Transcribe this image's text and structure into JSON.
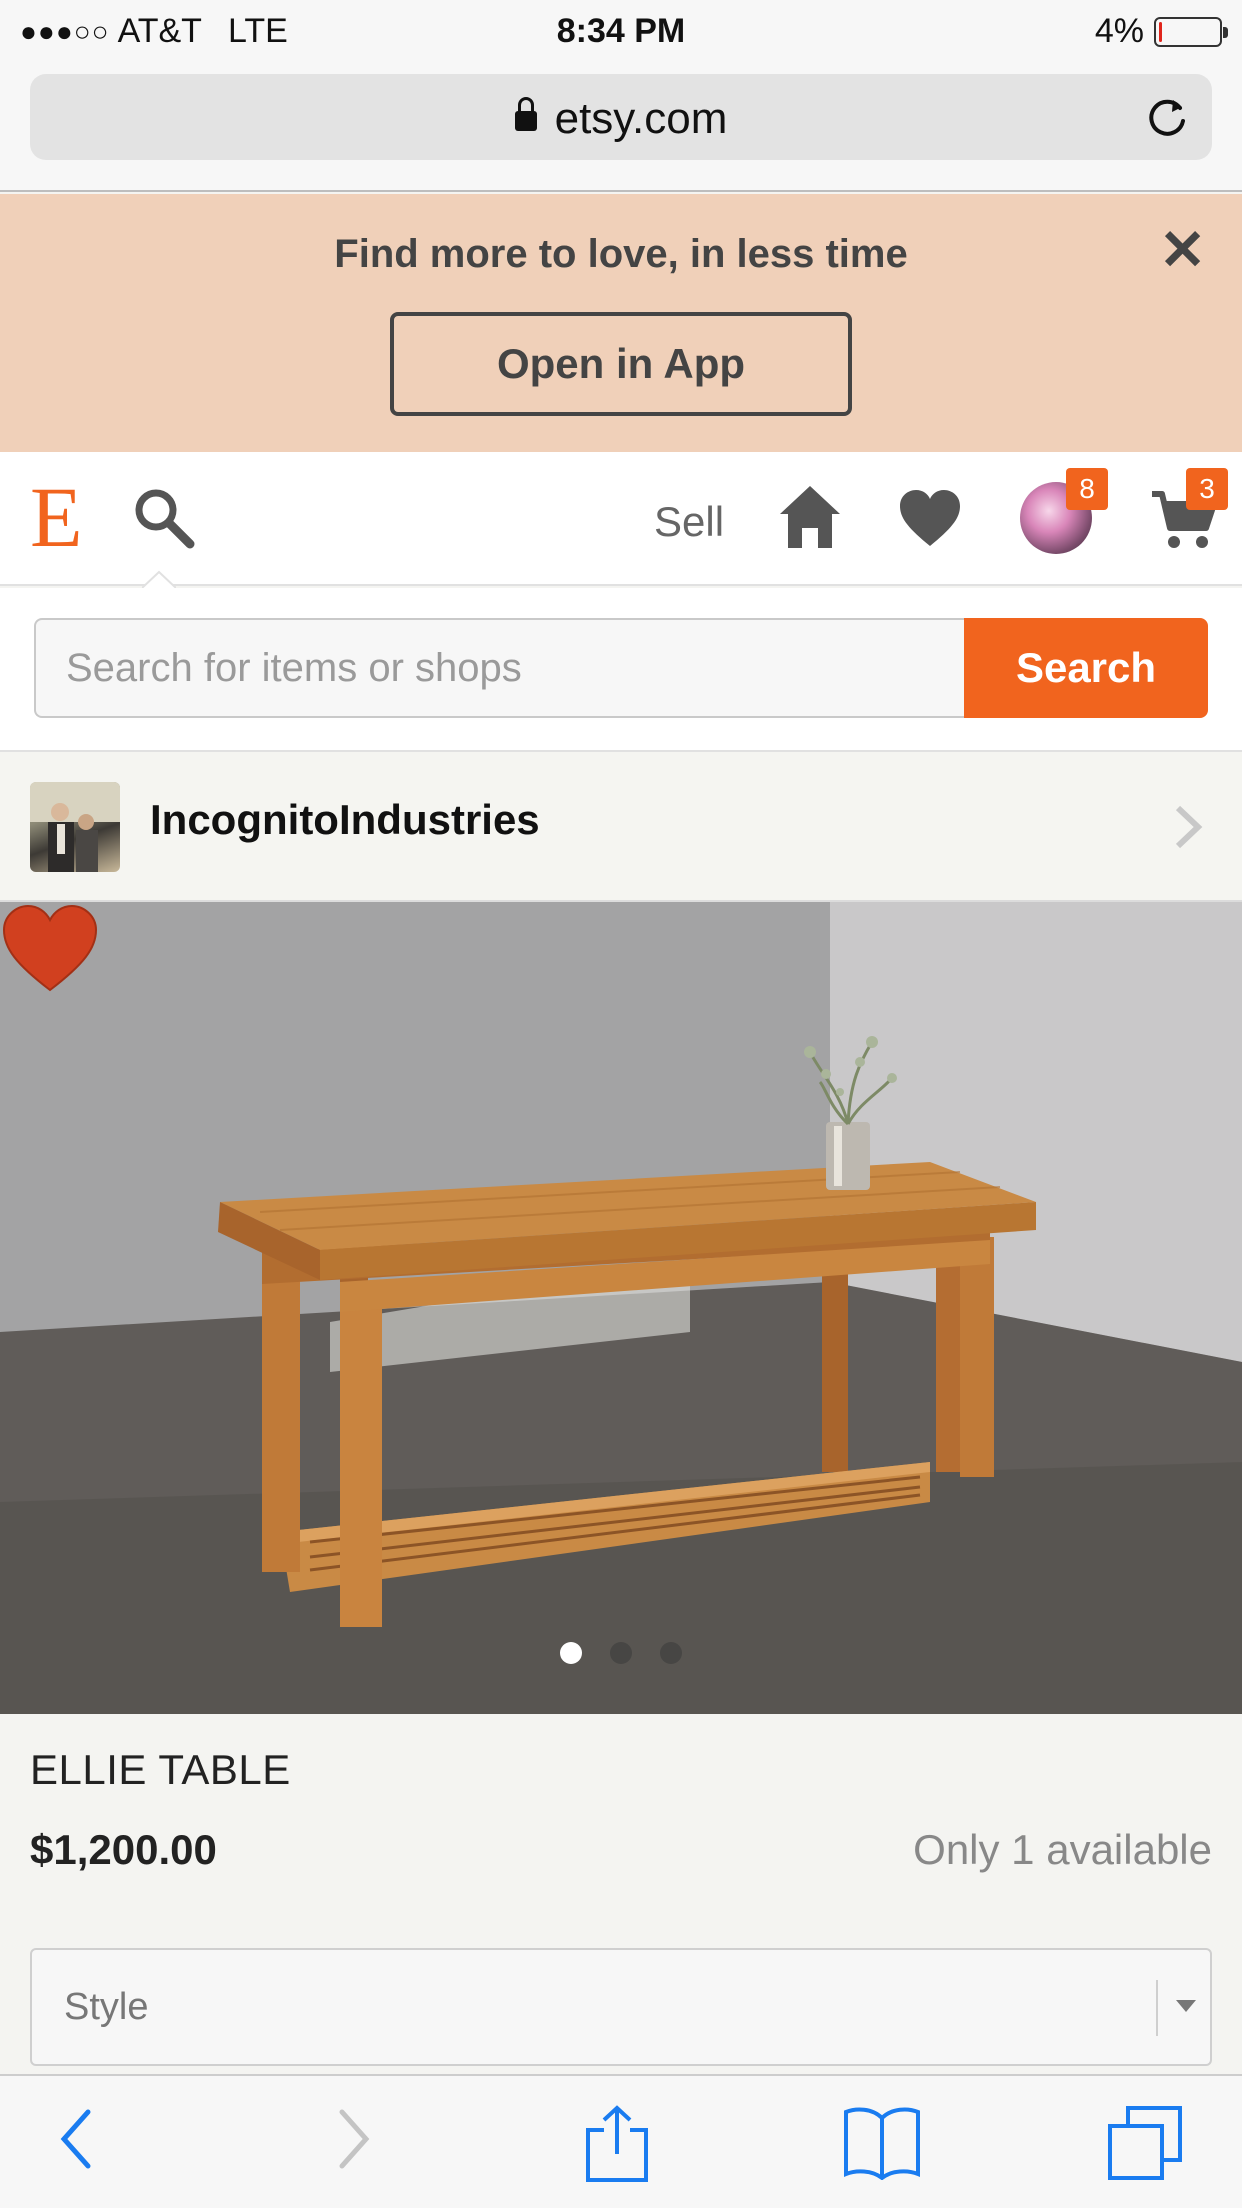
{
  "status_bar": {
    "signal": "●●●○○",
    "carrier": "AT&T",
    "network": "LTE",
    "time": "8:34 PM",
    "battery_percent": "4%",
    "battery_level": 0.04
  },
  "browser": {
    "url": "etsy.com"
  },
  "banner": {
    "message": "Find more to love, in less time",
    "close": "✕",
    "open_app": "Open in App"
  },
  "header": {
    "logo": "E",
    "sell": "Sell",
    "notifications_badge": "8",
    "cart_badge": "3"
  },
  "search": {
    "placeholder": "Search for items or shops",
    "button": "Search"
  },
  "shop": {
    "name": "IncognitoIndustries"
  },
  "product": {
    "pager_count": 3,
    "pager_active": 0,
    "title": "ELLIE TABLE",
    "price": "$1,200.00",
    "availability": "Only 1 available",
    "style_select": "Style"
  },
  "colors": {
    "brand": "#f1641e",
    "banner": "#f0d0b9",
    "favorite": "#d1401f",
    "ios_blue": "#1a7cf0"
  }
}
